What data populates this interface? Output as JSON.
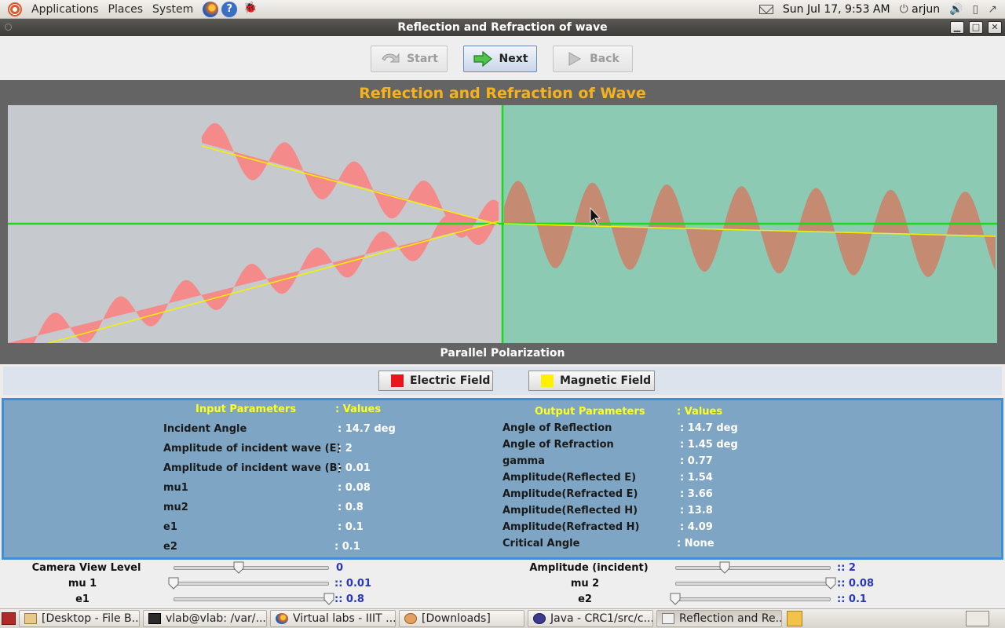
{
  "top_panel": {
    "menus": [
      "Applications",
      "Places",
      "System"
    ],
    "help_glyph": "?",
    "clock": "Sun Jul 17,  9:53 AM",
    "user": "arjun"
  },
  "window": {
    "title": "Reflection and Refraction of wave",
    "controls": [
      "minimize",
      "maximize",
      "close"
    ]
  },
  "nav": {
    "start_label": "Start",
    "next_label": "Next",
    "back_label": "Back"
  },
  "simulation": {
    "title": "Reflection and Refraction of Wave",
    "polarization": "Parallel Polarization",
    "colors": {
      "medium1": "#c6c9cd",
      "medium2": "#8dcab4",
      "incident_wave": "#f58a8a",
      "refracted_wave": "#c58a72",
      "axis": "#19dc19",
      "ray": "#f4f000"
    }
  },
  "legend": {
    "electric_label": "Electric Field",
    "electric_color": "#e8141e",
    "magnetic_label": "Magnetic Field",
    "magnetic_color": "#fff000"
  },
  "input_params": {
    "header": "Input Parameters",
    "values_header": ":  Values",
    "rows": [
      {
        "label": "Incident Angle",
        "value": ": 14.7 deg"
      },
      {
        "label": "Amplitude of incident wave (E)",
        "value": ": 2"
      },
      {
        "label": "Amplitude of incident wave (B)",
        "value": ": 0.01"
      },
      {
        "label": "mu1",
        "value": ": 0.08"
      },
      {
        "label": "mu2",
        "value": ": 0.8"
      },
      {
        "label": "e1",
        "value": ": 0.1"
      },
      {
        "label": "e2",
        "value": ": 0.1"
      }
    ]
  },
  "output_params": {
    "header": "Output Parameters",
    "values_header": ": Values",
    "rows": [
      {
        "label": "Angle of Reflection",
        "value": ": 14.7 deg"
      },
      {
        "label": "Angle of Refraction",
        "value": ": 1.45 deg"
      },
      {
        "label": "gamma",
        "value": ": 0.77"
      },
      {
        "label": "Amplitude(Reflected E)",
        "value": ": 1.54"
      },
      {
        "label": "Amplitude(Refracted E)",
        "value": ": 3.66"
      },
      {
        "label": "Amplitude(Reflected H)",
        "value": ": 13.8"
      },
      {
        "label": "Amplitude(Refracted H)",
        "value": ": 4.09"
      },
      {
        "label": "Critical Angle",
        "value": ": None"
      }
    ]
  },
  "controls": {
    "camera": {
      "label": "Camera View Level",
      "value": "0",
      "fraction": 0.42
    },
    "amplitude": {
      "label": "Amplitude (incident)",
      "value": ":: 2",
      "fraction": 0.32
    },
    "mu1": {
      "label": "mu 1",
      "value": ":: 0.01",
      "fraction": 0.0
    },
    "mu2": {
      "label": "mu 2",
      "value": ":: 0.08",
      "fraction": 1.0
    },
    "e1": {
      "label": "e1",
      "value": ":: 0.8",
      "fraction": 1.0
    },
    "e2": {
      "label": "e2",
      "value": ":: 0.1",
      "fraction": 0.0
    }
  },
  "taskbar": {
    "tasks": [
      {
        "label": "[Desktop - File B...",
        "icon": "folder-icon"
      },
      {
        "label": "vlab@vlab: /var/...",
        "icon": "terminal-icon"
      },
      {
        "label": "Virtual labs - IIIT ...",
        "icon": "firefox-icon"
      },
      {
        "label": "[Downloads]",
        "icon": "download-icon"
      },
      {
        "label": "Java - CRC1/src/c...",
        "icon": "eclipse-icon"
      },
      {
        "label": "Reflection and Re...",
        "icon": "java-icon"
      }
    ]
  }
}
